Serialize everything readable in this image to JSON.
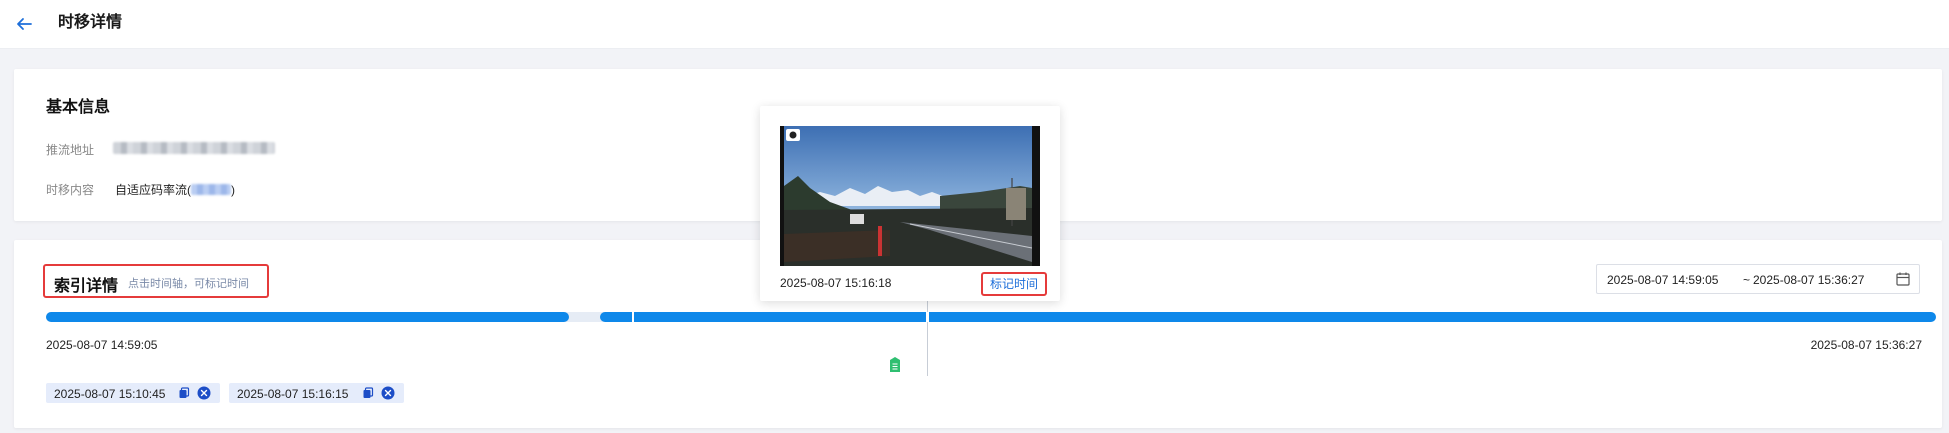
{
  "header": {
    "title": "时移详情",
    "back_icon": "arrow-left-icon"
  },
  "basic_info": {
    "title": "基本信息",
    "stream_url_label": "推流地址",
    "content_label": "时移内容",
    "content_value_prefix": "自适应码率流(",
    "content_value_suffix": ")"
  },
  "index_detail": {
    "title": "索引详情",
    "hint": "点击时间轴，可标记时间",
    "range_start": "2025-08-07 14:59:05",
    "range_separator": "~",
    "range_end": "2025-08-07 15:36:27",
    "calendar_icon": "calendar-icon",
    "timeline_start": "2025-08-07 14:59:05",
    "timeline_end": "2025-08-07 15:36:27",
    "marked_times": [
      {
        "time": "2025-08-07 15:10:45"
      },
      {
        "time": "2025-08-07 15:16:15"
      }
    ]
  },
  "preview": {
    "time": "2025-08-07 15:16:18",
    "mark_button": "标记时间"
  },
  "colors": {
    "accent": "#0e88ea",
    "highlight": "#e53b3b",
    "link": "#1e6fd9",
    "marker": "#2fbf71",
    "tag_bg": "#e5ecfb",
    "tag_close": "#1d4ec7"
  }
}
